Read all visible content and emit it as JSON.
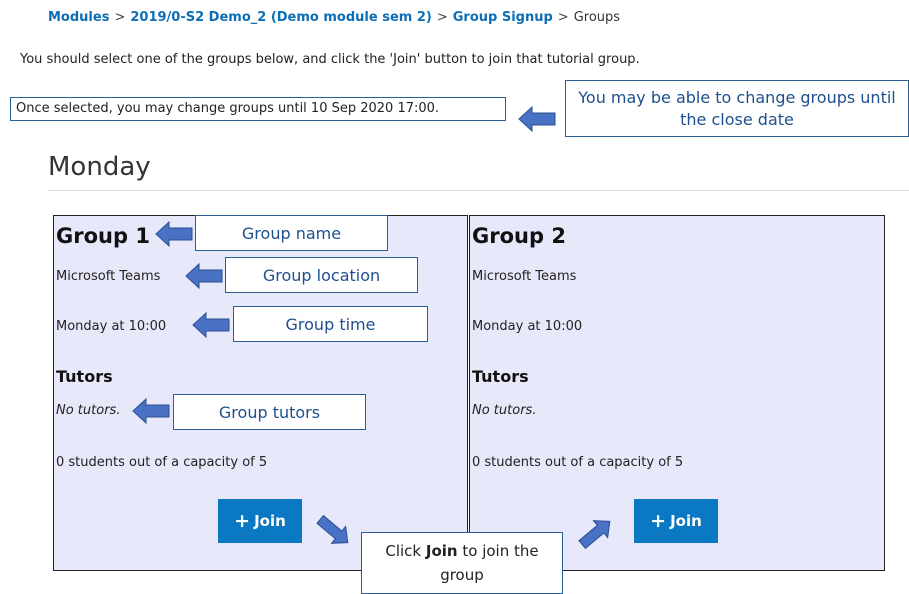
{
  "breadcrumb": {
    "items": [
      {
        "label": "Modules",
        "link": true
      },
      {
        "label": "2019/0-S2 Demo_2 (Demo module sem 2)",
        "link": true
      },
      {
        "label": "Group Signup",
        "link": true
      },
      {
        "label": "Groups",
        "link": false
      }
    ],
    "separator": ">"
  },
  "instruction": "You should select one of the groups below, and click the 'Join' button to join that tutorial group.",
  "change_notice": "Once selected, you may change groups until 10 Sep 2020 17:00.",
  "day_heading": "Monday",
  "groups": [
    {
      "name": "Group 1",
      "location": "Microsoft Teams",
      "time": "Monday at 10:00",
      "tutors_heading": "Tutors",
      "tutors": "No tutors.",
      "capacity": "0 students out of a capacity of 5",
      "join_label": "Join"
    },
    {
      "name": "Group 2",
      "location": "Microsoft Teams",
      "time": "Monday at 10:00",
      "tutors_heading": "Tutors",
      "tutors": "No tutors.",
      "capacity": "0 students out of a capacity of 5",
      "join_label": "Join"
    }
  ],
  "callouts": {
    "close_date": "You may be able to change groups until the close date",
    "group_name": "Group name",
    "group_location": "Group location",
    "group_time": "Group time",
    "group_tutors": "Group tutors",
    "join_prefix": "Click",
    "join_bold": "Join",
    "join_suffix_1": "to join the",
    "join_suffix_2": "group"
  },
  "colors": {
    "link": "#0c6fb5",
    "card_bg": "#e8e8fb",
    "join_button": "#0a78c2",
    "callout_border": "#2a5e94",
    "arrow": "#4a72c4"
  },
  "icons": {
    "join": "plus-icon",
    "pointer": "arrow-icon"
  }
}
